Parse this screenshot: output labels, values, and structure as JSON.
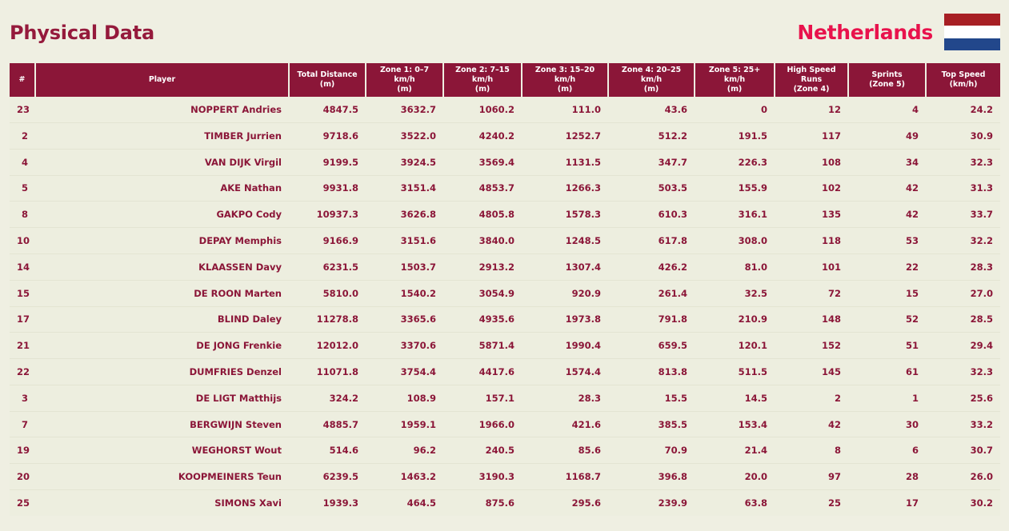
{
  "header": {
    "title": "Physical Data",
    "team_name": "Netherlands",
    "flag": {
      "name": "netherlands-flag",
      "stripes": [
        "#A71F24",
        "#FFFFFF",
        "#22478B"
      ]
    }
  },
  "theme": {
    "page_background": "#EFEFE2",
    "header_band": "#8B1638",
    "title_color": "#951A3C",
    "team_name_color": "#E8124C",
    "row_background": "#EDEEDF",
    "row_text": "#8B1638",
    "row_divider": "#E3E4D2",
    "faded_value": "#E6E7D6"
  },
  "table": {
    "columns": [
      {
        "key": "number",
        "label": "#",
        "sub": "",
        "align": "right"
      },
      {
        "key": "player",
        "label": "Player",
        "sub": "",
        "align": "left"
      },
      {
        "key": "total_distance",
        "label": "Total Distance",
        "sub": "(m)",
        "align": "right"
      },
      {
        "key": "zone1",
        "label": "Zone 1: 0–7 km/h",
        "sub": "(m)",
        "align": "right"
      },
      {
        "key": "zone2",
        "label": "Zone 2: 7–15 km/h",
        "sub": "(m)",
        "align": "right"
      },
      {
        "key": "zone3",
        "label": "Zone 3: 15–20 km/h",
        "sub": "(m)",
        "align": "right"
      },
      {
        "key": "zone4",
        "label": "Zone 4: 20–25 km/h",
        "sub": "(m)",
        "align": "right"
      },
      {
        "key": "zone5",
        "label": "Zone 5: 25+ km/h",
        "sub": "(m)",
        "align": "right"
      },
      {
        "key": "hsr",
        "label": "High Speed Runs",
        "sub": "(Zone 4)",
        "align": "right"
      },
      {
        "key": "sprints",
        "label": "Sprints",
        "sub": "(Zone 5)",
        "align": "right"
      },
      {
        "key": "top_speed",
        "label": "Top Speed",
        "sub": "(km/h)",
        "align": "right"
      }
    ],
    "rows": [
      {
        "number": "23",
        "player": "NOPPERT Andries",
        "total_distance": "4847.5",
        "zone1": "3632.7",
        "zone2": "1060.2",
        "zone3": "111.0",
        "zone4": "43.6",
        "zone5": "0",
        "zone5_faded": true,
        "hsr": "12",
        "sprints": "4",
        "top_speed": "24.2"
      },
      {
        "number": "2",
        "player": "TIMBER Jurrien",
        "total_distance": "9718.6",
        "zone1": "3522.0",
        "zone2": "4240.2",
        "zone3": "1252.7",
        "zone4": "512.2",
        "zone5": "191.5",
        "zone5_faded": false,
        "hsr": "117",
        "sprints": "49",
        "top_speed": "30.9"
      },
      {
        "number": "4",
        "player": "VAN DIJK Virgil",
        "total_distance": "9199.5",
        "zone1": "3924.5",
        "zone2": "3569.4",
        "zone3": "1131.5",
        "zone4": "347.7",
        "zone5": "226.3",
        "zone5_faded": false,
        "hsr": "108",
        "sprints": "34",
        "top_speed": "32.3"
      },
      {
        "number": "5",
        "player": "AKE Nathan",
        "total_distance": "9931.8",
        "zone1": "3151.4",
        "zone2": "4853.7",
        "zone3": "1266.3",
        "zone4": "503.5",
        "zone5": "155.9",
        "zone5_faded": false,
        "hsr": "102",
        "sprints": "42",
        "top_speed": "31.3"
      },
      {
        "number": "8",
        "player": "GAKPO Cody",
        "total_distance": "10937.3",
        "zone1": "3626.8",
        "zone2": "4805.8",
        "zone3": "1578.3",
        "zone4": "610.3",
        "zone5": "316.1",
        "zone5_faded": false,
        "hsr": "135",
        "sprints": "42",
        "top_speed": "33.7"
      },
      {
        "number": "10",
        "player": "DEPAY Memphis",
        "total_distance": "9166.9",
        "zone1": "3151.6",
        "zone2": "3840.0",
        "zone3": "1248.5",
        "zone4": "617.8",
        "zone5": "308.0",
        "zone5_faded": false,
        "hsr": "118",
        "sprints": "53",
        "top_speed": "32.2"
      },
      {
        "number": "14",
        "player": "KLAASSEN Davy",
        "total_distance": "6231.5",
        "zone1": "1503.7",
        "zone2": "2913.2",
        "zone3": "1307.4",
        "zone4": "426.2",
        "zone5": "81.0",
        "zone5_faded": false,
        "hsr": "101",
        "sprints": "22",
        "top_speed": "28.3"
      },
      {
        "number": "15",
        "player": "DE ROON Marten",
        "total_distance": "5810.0",
        "zone1": "1540.2",
        "zone2": "3054.9",
        "zone3": "920.9",
        "zone4": "261.4",
        "zone5": "32.5",
        "zone5_faded": false,
        "hsr": "72",
        "sprints": "15",
        "top_speed": "27.0"
      },
      {
        "number": "17",
        "player": "BLIND Daley",
        "total_distance": "11278.8",
        "zone1": "3365.6",
        "zone2": "4935.6",
        "zone3": "1973.8",
        "zone4": "791.8",
        "zone5": "210.9",
        "zone5_faded": false,
        "hsr": "148",
        "sprints": "52",
        "top_speed": "28.5"
      },
      {
        "number": "21",
        "player": "DE JONG Frenkie",
        "total_distance": "12012.0",
        "zone1": "3370.6",
        "zone2": "5871.4",
        "zone3": "1990.4",
        "zone4": "659.5",
        "zone5": "120.1",
        "zone5_faded": false,
        "hsr": "152",
        "sprints": "51",
        "top_speed": "29.4"
      },
      {
        "number": "22",
        "player": "DUMFRIES Denzel",
        "total_distance": "11071.8",
        "zone1": "3754.4",
        "zone2": "4417.6",
        "zone3": "1574.4",
        "zone4": "813.8",
        "zone5": "511.5",
        "zone5_faded": false,
        "hsr": "145",
        "sprints": "61",
        "top_speed": "32.3"
      },
      {
        "number": "3",
        "player": "DE LIGT Matthijs",
        "total_distance": "324.2",
        "zone1": "108.9",
        "zone2": "157.1",
        "zone3": "28.3",
        "zone4": "15.5",
        "zone5": "14.5",
        "zone5_faded": false,
        "hsr": "2",
        "sprints": "1",
        "top_speed": "25.6"
      },
      {
        "number": "7",
        "player": "BERGWIJN Steven",
        "total_distance": "4885.7",
        "zone1": "1959.1",
        "zone2": "1966.0",
        "zone3": "421.6",
        "zone4": "385.5",
        "zone5": "153.4",
        "zone5_faded": false,
        "hsr": "42",
        "sprints": "30",
        "top_speed": "33.2"
      },
      {
        "number": "19",
        "player": "WEGHORST Wout",
        "total_distance": "514.6",
        "zone1": "96.2",
        "zone2": "240.5",
        "zone3": "85.6",
        "zone4": "70.9",
        "zone5": "21.4",
        "zone5_faded": false,
        "hsr": "8",
        "sprints": "6",
        "top_speed": "30.7"
      },
      {
        "number": "20",
        "player": "KOOPMEINERS Teun",
        "total_distance": "6239.5",
        "zone1": "1463.2",
        "zone2": "3190.3",
        "zone3": "1168.7",
        "zone4": "396.8",
        "zone5": "20.0",
        "zone5_faded": false,
        "hsr": "97",
        "sprints": "28",
        "top_speed": "26.0"
      },
      {
        "number": "25",
        "player": "SIMONS Xavi",
        "total_distance": "1939.3",
        "zone1": "464.5",
        "zone2": "875.6",
        "zone3": "295.6",
        "zone4": "239.9",
        "zone5": "63.8",
        "zone5_faded": false,
        "hsr": "25",
        "sprints": "17",
        "top_speed": "30.2"
      }
    ]
  }
}
